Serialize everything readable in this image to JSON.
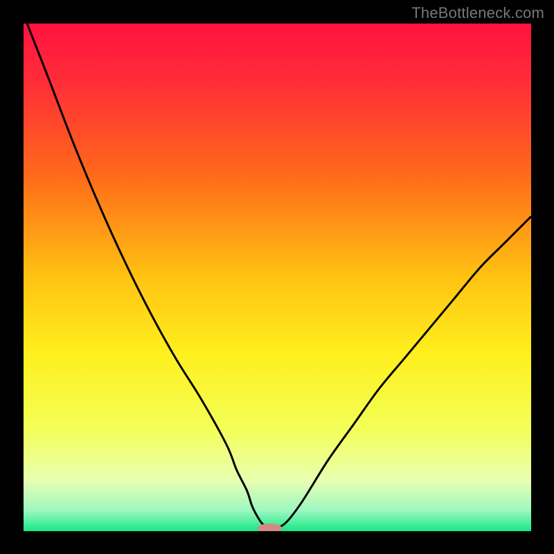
{
  "watermark": "TheBottleneck.com",
  "colors": {
    "background": "#000000",
    "curve_stroke": "#000000",
    "marker_fill": "#d48a84",
    "gradient_stops": [
      {
        "offset": 0.0,
        "color": "#ff1240"
      },
      {
        "offset": 0.12,
        "color": "#ff2f37"
      },
      {
        "offset": 0.3,
        "color": "#ff6a1a"
      },
      {
        "offset": 0.5,
        "color": "#ffc312"
      },
      {
        "offset": 0.65,
        "color": "#ffef1d"
      },
      {
        "offset": 0.8,
        "color": "#f3ff58"
      },
      {
        "offset": 0.9,
        "color": "#e8ffb1"
      },
      {
        "offset": 0.96,
        "color": "#9cf7c0"
      },
      {
        "offset": 1.0,
        "color": "#17e885"
      }
    ]
  },
  "chart_data": {
    "type": "line",
    "title": "",
    "xlabel": "",
    "ylabel": "",
    "xlim": [
      0,
      100
    ],
    "ylim": [
      0,
      100
    ],
    "x": [
      0.7,
      5,
      10,
      15,
      20,
      25,
      30,
      35,
      40,
      42,
      44,
      45,
      46,
      47,
      48,
      49,
      50,
      52,
      55,
      60,
      65,
      70,
      75,
      80,
      85,
      90,
      95,
      100
    ],
    "values": [
      100,
      89,
      76,
      64,
      53,
      43,
      34,
      26,
      17,
      12,
      8,
      5,
      3,
      1.5,
      0.8,
      0.6,
      0.6,
      2,
      6,
      14,
      21,
      28,
      34,
      40,
      46,
      52,
      57,
      62
    ],
    "marker": {
      "x": 48.5,
      "y": 0.6,
      "rx": 2.4,
      "ry": 0.9
    }
  }
}
